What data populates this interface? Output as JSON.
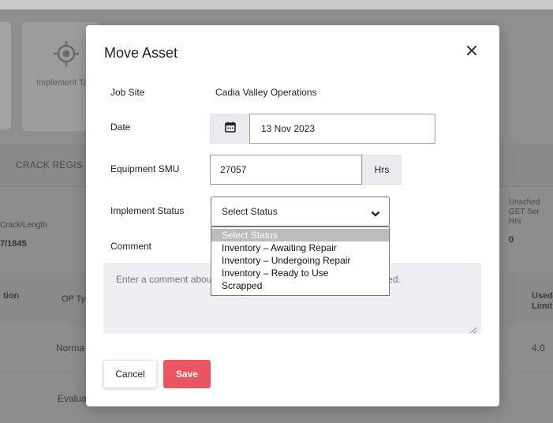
{
  "background": {
    "tile_label": "Implement Targets",
    "tab_crack": "CRACK REGIS",
    "stat_crack_label": "Crack/Length",
    "stat_crack_value": "7/1845",
    "stat_right_label": "Unsched GET Ser Hrs",
    "stat_right_value": "0",
    "col_position": "tion",
    "col_op_type": "OP Ty",
    "col_used_limit": "Used Limit",
    "row1_op": "Norma",
    "row1_used": "4.0",
    "row2_op": "Evalua"
  },
  "modal": {
    "title": "Move Asset",
    "job_site_label": "Job Site",
    "job_site_value": "Cadia Valley Operations",
    "date_label": "Date",
    "date_value": "13 Nov 2023",
    "smu_label": "Equipment SMU",
    "smu_value": "27057",
    "smu_unit": "Hrs",
    "status_label": "Implement Status",
    "status_selected": "Select Status",
    "status_options": [
      "Select Status",
      "Inventory – Awaiting Repair",
      "Inventory – Undergoing Repair",
      "Inventory – Ready to Use",
      "Scrapped"
    ],
    "comment_label": "Comment",
    "comment_placeholder": "Enter a comment about why the implement status is being changed.",
    "cancel_label": "Cancel",
    "save_label": "Save"
  },
  "colors": {
    "save_button": "#e95662",
    "overlay": "#8d8d8d",
    "input_addon": "#e9ebee",
    "dropdown_highlight": "#bcbcbc"
  }
}
